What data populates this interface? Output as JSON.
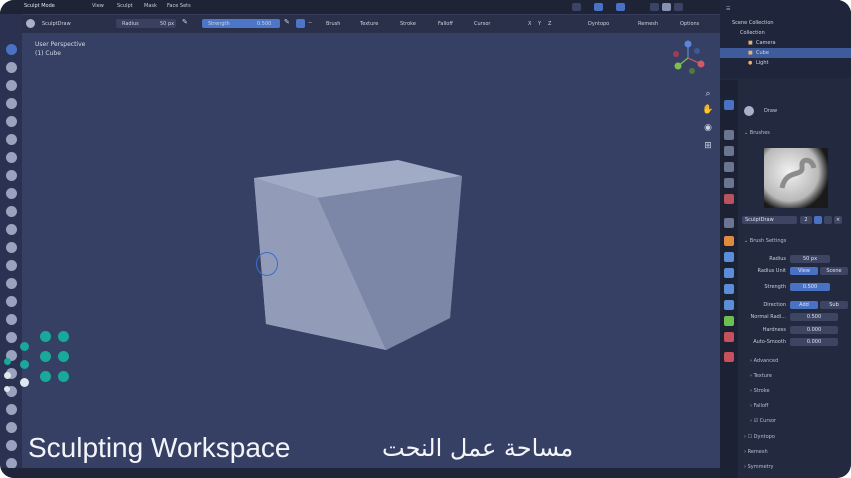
{
  "topbar": {
    "mode": "Sculpt Mode",
    "menu": [
      "View",
      "Sculpt",
      "Mask",
      "Face Sets"
    ]
  },
  "toolbar": {
    "brush_name": "SculptDraw",
    "radius_label": "Radius",
    "radius_value": "50 px",
    "strength_label": "Strength",
    "strength_value": "0.500",
    "menus": [
      "Brush",
      "Texture",
      "Stroke",
      "Falloff",
      "Cursor"
    ],
    "axes": [
      "X",
      "Y",
      "Z"
    ],
    "right_menus": [
      "Dyntopo",
      "Remesh",
      "Options"
    ]
  },
  "viewport": {
    "view_name": "User Perspective",
    "object_name": "(1) Cube"
  },
  "outliner": {
    "items": [
      "Scene Collection",
      "Collection",
      "Camera",
      "Cube",
      "Light"
    ]
  },
  "properties": {
    "tool_name": "Draw",
    "brushes_header": "Brushes",
    "brush_slot": "SculptDraw",
    "brush_users": "2",
    "brush_settings_header": "Brush Settings",
    "radius_label": "Radius",
    "radius_value": "50 px",
    "radius_unit_label": "Radius Unit",
    "radius_unit_options": [
      "View",
      "Scene"
    ],
    "strength_label": "Strength",
    "strength_value": "0.500",
    "direction_label": "Direction",
    "direction_options": [
      "Add",
      "Sub"
    ],
    "normal_radius_label": "Normal Radi...",
    "normal_radius_value": "0.500",
    "hardness_label": "Hardness",
    "hardness_value": "0.000",
    "auto_smooth_label": "Auto-Smooth",
    "auto_smooth_value": "0.000",
    "subsections": [
      "Advanced",
      "Texture",
      "Stroke",
      "Falloff",
      "Cursor"
    ],
    "more_sections": [
      "Dyntopo",
      "Remesh",
      "Symmetry"
    ]
  },
  "caption": {
    "english": "Sculpting Workspace",
    "arabic": "مساحة عمل النحت"
  },
  "colors": {
    "viewport_bg": "#364064",
    "accent_blue": "#4a72c4",
    "logo_teal": "#1aa89b",
    "cube_face": "#8e98b6"
  }
}
